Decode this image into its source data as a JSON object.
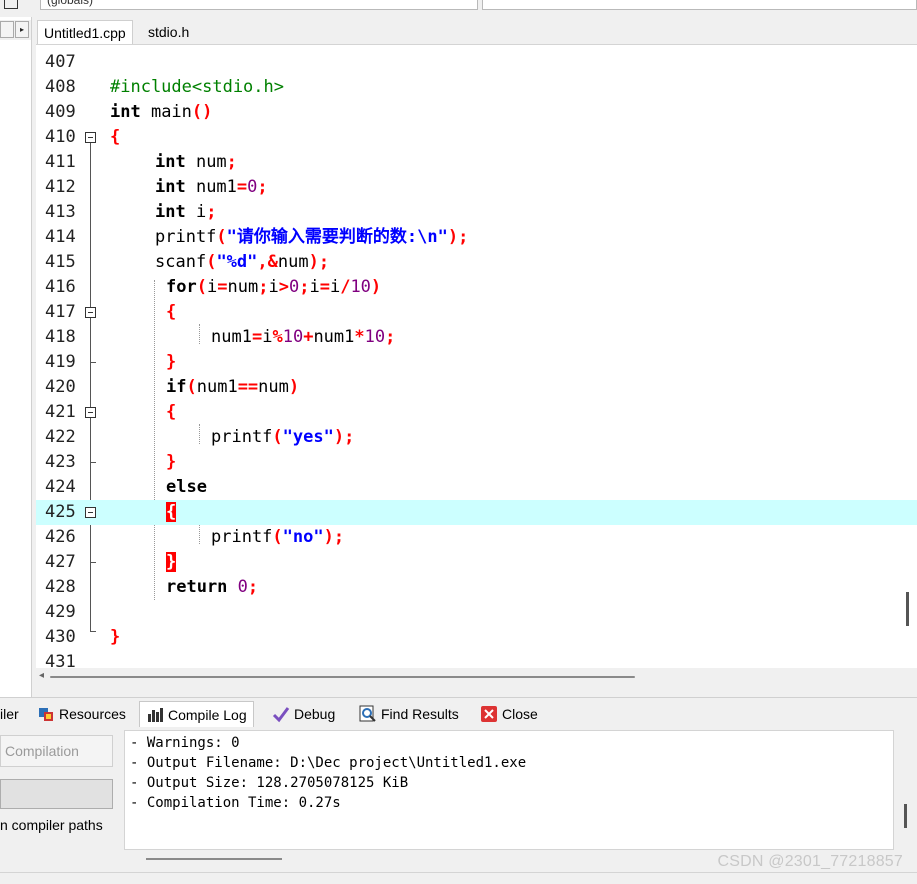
{
  "toolbar": {
    "scope_combo": "(globals)",
    "symbol_combo": ""
  },
  "nav": {
    "right_arrow": "▸"
  },
  "tabs": [
    {
      "label": "Untitled1.cpp",
      "active": true
    },
    {
      "label": "stdio.h",
      "active": false
    }
  ],
  "editor": {
    "lines": [
      {
        "n": "407"
      },
      {
        "n": "408"
      },
      {
        "n": "409"
      },
      {
        "n": "410"
      },
      {
        "n": "411"
      },
      {
        "n": "412"
      },
      {
        "n": "413"
      },
      {
        "n": "414"
      },
      {
        "n": "415"
      },
      {
        "n": "416"
      },
      {
        "n": "417"
      },
      {
        "n": "418"
      },
      {
        "n": "419"
      },
      {
        "n": "420"
      },
      {
        "n": "421"
      },
      {
        "n": "422"
      },
      {
        "n": "423"
      },
      {
        "n": "424"
      },
      {
        "n": "425"
      },
      {
        "n": "426"
      },
      {
        "n": "427"
      },
      {
        "n": "428"
      },
      {
        "n": "429"
      },
      {
        "n": "430"
      },
      {
        "n": "431"
      }
    ],
    "code": {
      "l408_include": "#include<stdio.h>",
      "l409_int": "int",
      "l409_main": " main",
      "l409_parens": "()",
      "open_brace": "{",
      "close_brace": "}",
      "kw_int": "int",
      "l411_var": " num",
      "semi": ";",
      "l412_var": " num1",
      "eq": "=",
      "zero": "0",
      "l413_var": " i",
      "l414_fn": "printf",
      "lparen": "(",
      "rparen": ")",
      "l414_str": "\"请你输入需要判断的数:\\n\"",
      "l415_fn": "scanf",
      "l415_str": "\"%d\"",
      "comma_amp": ",&",
      "l415_arg": "num",
      "kw_for": "for",
      "l416_i": "i",
      "l416_num": "num",
      "gt": ">",
      "l416_div": "/",
      "ten": "10",
      "l418_num1": "num1",
      "l418_i": "i",
      "pct": "%",
      "plus": "+",
      "star": "*",
      "kw_if": "if",
      "l420_num1": "num1",
      "eqeq": "==",
      "l420_num": "num",
      "l422_fn": "printf",
      "l422_str": "\"yes\"",
      "kw_else": "else",
      "l426_fn": "printf",
      "l426_str": "\"no\"",
      "kw_return": "return",
      "space": " "
    }
  },
  "bottom_tabs": [
    {
      "label": "iler",
      "icon": "compiler-icon"
    },
    {
      "label": "Resources",
      "icon": "resources-icon"
    },
    {
      "label": "Compile Log",
      "icon": "compile-log-icon",
      "active": true
    },
    {
      "label": "Debug",
      "icon": "debug-icon"
    },
    {
      "label": "Find Results",
      "icon": "find-results-icon"
    },
    {
      "label": "Close",
      "icon": "close-icon"
    }
  ],
  "compile_panel": {
    "compilation_button": "Compilation",
    "paths_label": "n compiler paths"
  },
  "log": [
    "- Warnings: 0",
    "- Output Filename: D:\\Dec project\\Untitled1.exe",
    "- Output Size: 128.2705078125 KiB",
    "- Compilation Time: 0.27s"
  ],
  "watermark": "CSDN @2301_77218857",
  "colors": {
    "current_line": "#ccffff",
    "keyword": "#000000",
    "string": "#0000ff",
    "number": "#800080",
    "symbol": "#ff0000",
    "preprocessor": "#008000"
  }
}
